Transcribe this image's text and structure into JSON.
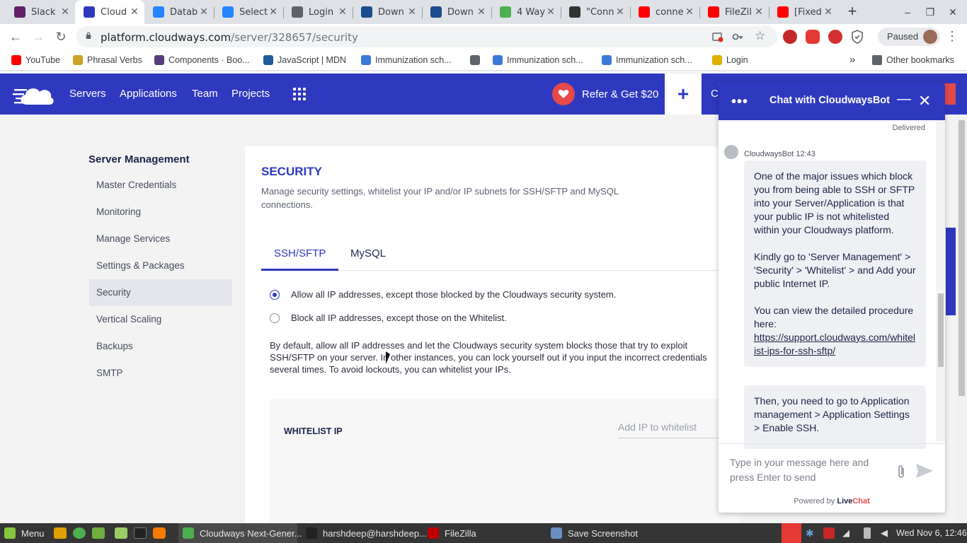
{
  "browser": {
    "tabs": [
      {
        "title": "Slack",
        "icon": "slack-icon",
        "color": "#611f69"
      },
      {
        "title": "Cloud",
        "icon": "cloudways-icon",
        "color": "#2f39bf",
        "active": true
      },
      {
        "title": "Datab",
        "icon": "confluence-icon",
        "color": "#2684ff"
      },
      {
        "title": "Select",
        "icon": "confluence-icon",
        "color": "#2684ff"
      },
      {
        "title": "Login",
        "icon": "globe-icon",
        "color": "#5f6368"
      },
      {
        "title": "Down",
        "icon": "download-icon",
        "color": "#1a4d8f"
      },
      {
        "title": "Down",
        "icon": "download-icon",
        "color": "#1a4d8f"
      },
      {
        "title": "4 Way",
        "icon": "site-icon",
        "color": "#4caf50"
      },
      {
        "title": "\"Conn",
        "icon": "site-icon",
        "color": "#333333"
      },
      {
        "title": "conne",
        "icon": "youtube-icon",
        "color": "#ff0000"
      },
      {
        "title": "FileZil",
        "icon": "youtube-icon",
        "color": "#ff0000"
      },
      {
        "title": "[Fixed",
        "icon": "youtube-icon",
        "color": "#ff0000"
      }
    ],
    "new_tab": "+",
    "window_controls": [
      "–",
      "❐",
      "✕"
    ],
    "nav": {
      "back": "←",
      "forward": "→",
      "reload": "↻"
    },
    "url_domain": "platform.cloudways.com",
    "url_path": "/server/328657/security",
    "profile_label": "Paused",
    "bookmarks": [
      {
        "label": "YouTube",
        "icon": "youtube-icon",
        "color": "#ff0000"
      },
      {
        "label": "Phrasal Verbs",
        "icon": "bookmark-icon",
        "color": "#c9a227"
      },
      {
        "label": "Components · Boo...",
        "icon": "bootstrap-icon",
        "color": "#563d7c"
      },
      {
        "label": "JavaScript | MDN",
        "icon": "mdn-icon",
        "color": "#1f5c99"
      },
      {
        "label": "Immunization sch...",
        "icon": "who-icon",
        "color": "#3c78d8"
      },
      {
        "label": "",
        "icon": "globe-icon",
        "color": "#5f6368"
      },
      {
        "label": "Immunization sch...",
        "icon": "who-icon",
        "color": "#3c78d8"
      },
      {
        "label": "Immunization sch...",
        "icon": "who-icon",
        "color": "#3c78d8"
      },
      {
        "label": "Login",
        "icon": "bolt-icon",
        "color": "#e0b000"
      }
    ],
    "bookmarks_overflow": "»",
    "other_bookmarks": "Other bookmarks"
  },
  "app": {
    "brand_color": "#2f39bf",
    "nav": [
      "Servers",
      "Applications",
      "Team",
      "Projects"
    ],
    "refer_label": "Refer & Get $20",
    "plus_label": "+",
    "header_partial": "C"
  },
  "sidebar": {
    "title": "Server Management",
    "items": [
      {
        "label": "Master Credentials"
      },
      {
        "label": "Monitoring"
      },
      {
        "label": "Manage Services"
      },
      {
        "label": "Settings & Packages"
      },
      {
        "label": "Security",
        "selected": true
      },
      {
        "label": "Vertical Scaling"
      },
      {
        "label": "Backups"
      },
      {
        "label": "SMTP"
      }
    ]
  },
  "security": {
    "title": "SECURITY",
    "description": "Manage security settings, whitelist your IP and/or IP subnets for SSH/SFTP and MySQL connections.",
    "tabs": [
      "SSH/SFTP",
      "MySQL"
    ],
    "options": [
      {
        "label": "Allow all IP addresses, except those blocked by the Cloudways security system.",
        "checked": true
      },
      {
        "label": "Block all IP addresses, except those on the Whitelist.",
        "checked": false
      }
    ],
    "info": "By default, allow all IP addresses and let the Cloudways security system blocks those that try to exploit SSH/SFTP on your server. In other instances, you can lock yourself out if you input the incorrect credentials several times. To avoid lockouts, you can whitelist your IPs.",
    "whitelist_title": "WHITELIST IP",
    "whitelist_placeholder": "Add IP to whitelist"
  },
  "chat": {
    "title": "Chat with CloudwaysBot",
    "menu_label": "•••",
    "minimize_label": "—",
    "close_label": "✕",
    "delivered": "Delivered",
    "sender": "CloudwaysBot 12:43",
    "messages": [
      {
        "paragraphs": [
          "One of the major issues which block you from being able to SSH or SFTP into your Server/Application is that your public IP is not whitelisted within your Cloudways platform.",
          "Kindly go to 'Server Management' > 'Security' > 'Whitelist' > and Add your public Internet IP.",
          "You can view the detailed procedure here:"
        ],
        "link": "https://support.cloudways.com/whitelist-ips-for-ssh-sftp/"
      },
      {
        "paragraphs": [
          "Then, you need to go to Application management > Application Settings > Enable SSH."
        ]
      }
    ],
    "input_placeholder": "Type in your message here and press Enter to send",
    "powered_prefix": "Powered by",
    "powered_brand_a": "Live",
    "powered_brand_b": "Chat"
  },
  "taskbar": {
    "menu_label": "Menu",
    "windows": [
      {
        "label": "Cloudways Next-Gener...",
        "icon": "chrome-icon",
        "color": "#4caf50",
        "active": true
      },
      {
        "label": "harshdeep@harshdeep...",
        "icon": "terminal-icon",
        "color": "#222222"
      },
      {
        "label": "FileZilla",
        "icon": "filezilla-icon",
        "color": "#bf0000"
      },
      {
        "label": "Save Screenshot",
        "icon": "camera-icon",
        "color": "#6a8fc0"
      }
    ],
    "clock": "Wed Nov 6, 12:46"
  }
}
